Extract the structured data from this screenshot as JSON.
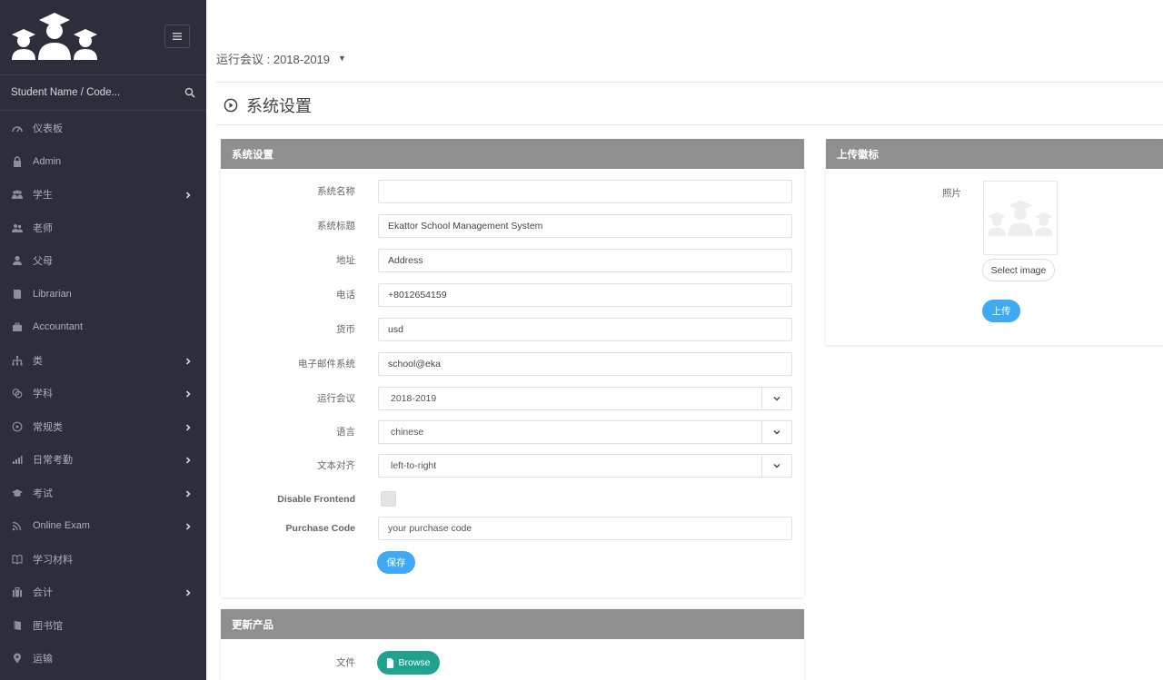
{
  "sidebar": {
    "search_placeholder": "Student Name / Code...",
    "items": [
      {
        "label": "仪表板",
        "icon": "dashboard-icon",
        "has_children": false
      },
      {
        "label": "Admin",
        "icon": "lock-icon",
        "has_children": false
      },
      {
        "label": "学生",
        "icon": "users-group-icon",
        "has_children": true
      },
      {
        "label": "老师",
        "icon": "user-pair-icon",
        "has_children": false
      },
      {
        "label": "父母",
        "icon": "user-icon",
        "has_children": false
      },
      {
        "label": "Librarian",
        "icon": "book-icon",
        "has_children": false
      },
      {
        "label": "Accountant",
        "icon": "briefcase-icon",
        "has_children": false
      },
      {
        "label": "类",
        "icon": "hierarchy-icon",
        "has_children": true
      },
      {
        "label": "学科",
        "icon": "books-icon",
        "has_children": true
      },
      {
        "label": "常规类",
        "icon": "target-icon",
        "has_children": true
      },
      {
        "label": "日常考勤",
        "icon": "bar-chart-icon",
        "has_children": true
      },
      {
        "label": "考试",
        "icon": "graduation-cap-icon",
        "has_children": true
      },
      {
        "label": "Online Exam",
        "icon": "rss-icon",
        "has_children": true
      },
      {
        "label": "学习材料",
        "icon": "open-book-icon",
        "has_children": false
      },
      {
        "label": "会计",
        "icon": "suitcase-icon",
        "has_children": true
      },
      {
        "label": "图书馆",
        "icon": "library-book-icon",
        "has_children": false
      },
      {
        "label": "运输",
        "icon": "map-pin-icon",
        "has_children": false
      }
    ]
  },
  "topbar": {
    "session_label": "运行会议 : 2018-2019"
  },
  "page": {
    "title": "系统设置"
  },
  "settings_panel": {
    "title": "系统设置",
    "fields": {
      "system_name": {
        "label": "系统名称",
        "value": ""
      },
      "system_title": {
        "label": "系统标题",
        "value": "Ekattor School Management System"
      },
      "address": {
        "label": "地址",
        "value": "Address"
      },
      "phone": {
        "label": "电话",
        "value": "+8012654159"
      },
      "currency": {
        "label": "货币",
        "value": "usd"
      },
      "email": {
        "label": "电子邮件系统",
        "value": "school@eka"
      },
      "running_session": {
        "label": "运行会议",
        "value": "2018-2019"
      },
      "language": {
        "label": "语言",
        "value": "chinese"
      },
      "text_align": {
        "label": "文本对齐",
        "value": "left-to-right"
      },
      "disable_frontend": {
        "label": "Disable Frontend"
      },
      "purchase_code": {
        "label": "Purchase Code",
        "placeholder": "your purchase code"
      }
    },
    "save_label": "保存"
  },
  "update_panel": {
    "title": "更新产品",
    "file_label": "文件",
    "browse_label": "Browse"
  },
  "logo_panel": {
    "title": "上传徽标",
    "photo_label": "照片",
    "select_image_label": "Select image",
    "upload_label": "上传"
  },
  "colors": {
    "sidebar_bg": "#2c2f3b",
    "panel_header": "#8f8f8f",
    "primary_blue": "#3fa9f5",
    "browse_green": "#1fa38f"
  }
}
